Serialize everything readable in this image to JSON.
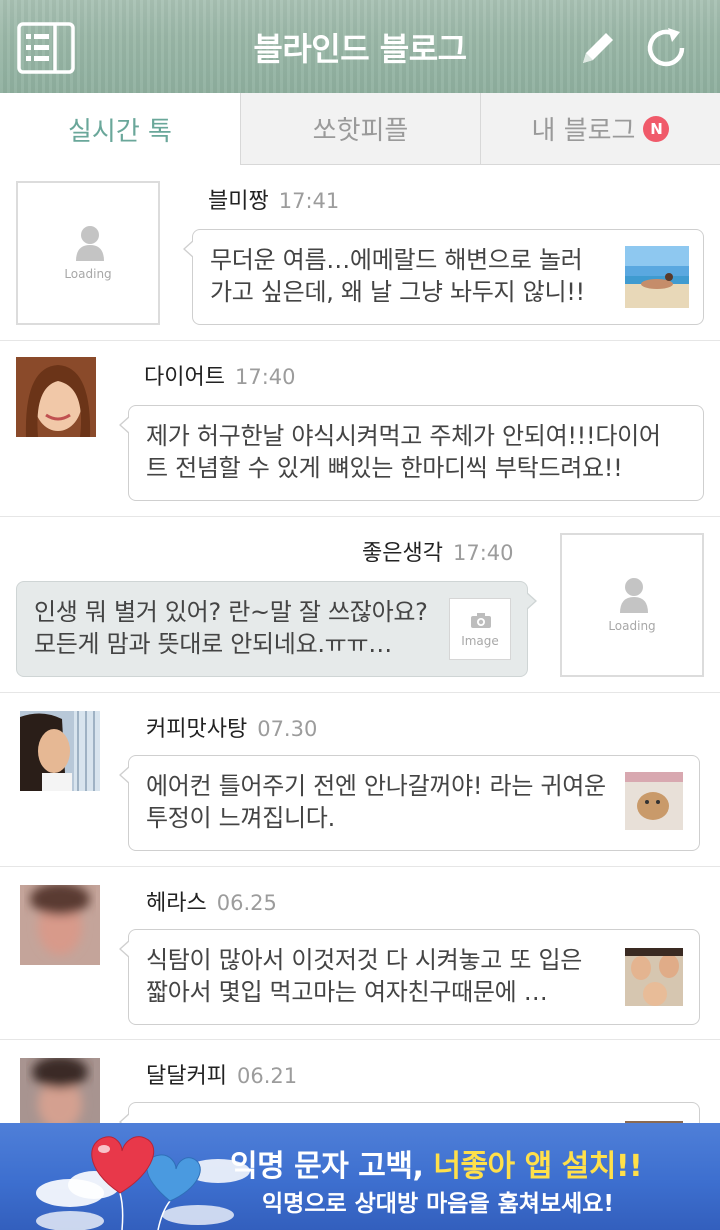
{
  "header": {
    "title": "블라인드 블로그"
  },
  "tabs": [
    {
      "label": "실시간 톡"
    },
    {
      "label": "쏘핫피플"
    },
    {
      "label": "내 블로그",
      "badge": "N"
    }
  ],
  "placeholder_loading": "Loading",
  "placeholder_image": "Image",
  "posts": [
    {
      "name": "블미짱",
      "time": "17:41",
      "line1": "무더운 여름…에메랄드 해변으로 놀러",
      "line2": "가고 싶은데, 왜 날 그냥 놔두지 않니!!"
    },
    {
      "name": "다이어트",
      "time": "17:40",
      "line1": "제가 허구한날 야식시켜먹고 주체가 안되여!!!다이어",
      "line2": "트 전념할 수 있게 뼈있는 한마디씩 부탁드려요!!"
    },
    {
      "name": "좋은생각",
      "time": "17:40",
      "line1": "인생 뭐 별거 있어? 란~말 잘 쓰잖아요?",
      "line2": "모든게 맘과 뜻대로 안되네요.ㅠㅠ…"
    },
    {
      "name": "커피맛사탕",
      "time": "07.30",
      "line1": "에어컨 틀어주기 전엔 안나갈꺼야! 라는 귀여운",
      "line2": "투정이 느껴집니다."
    },
    {
      "name": "헤라스",
      "time": "06.25",
      "line1": "식탐이 많아서 이것저것 다 시켜놓고 또 입은",
      "line2": "짧아서 몇입 먹고마는 여자친구때문에 …"
    },
    {
      "name": "달달커피",
      "time": "06.21",
      "line1": "",
      "line2": ""
    }
  ],
  "banner": {
    "part1": "익명 문자 고백, ",
    "part2": "너좋아",
    "part3": " 앱 설치!!",
    "subtitle": "익명으로 상대방 마음을 훔쳐보세요!"
  },
  "colors": {
    "active_tab": "#6aa79a",
    "badge": "#f05a6a",
    "banner": "#3d6fcf"
  }
}
